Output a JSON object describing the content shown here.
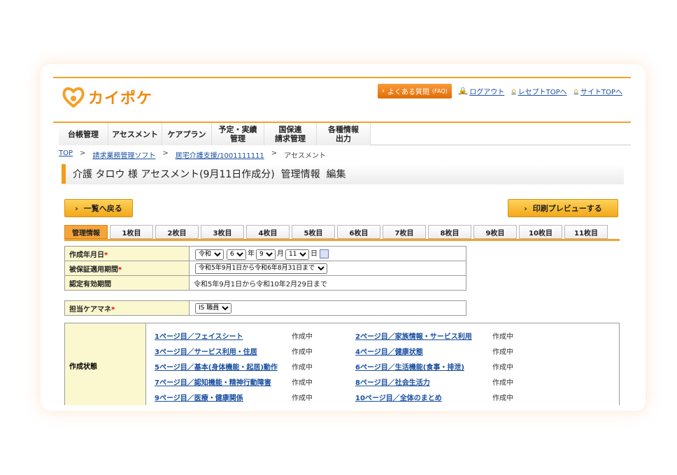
{
  "header": {
    "logo_text": "カイポケ",
    "faq_label": "よくある質問",
    "faq_suffix": "(FAQ)",
    "logout_label": "ログアウト",
    "receipt_top_label": "レセプトTOPへ",
    "site_top_label": "サイトTOPへ"
  },
  "nav": [
    {
      "label": "台帳管理"
    },
    {
      "label": "アセスメント"
    },
    {
      "label": "ケアプラン"
    },
    {
      "label": "予定・実績\n管理"
    },
    {
      "label": "国保連\n請求管理"
    },
    {
      "label": "各種情報\n出力"
    }
  ],
  "breadcrumb": {
    "top": "TOP",
    "sep": ">",
    "billing": "請求業務管理ソフト",
    "office": "居宅介護支援/1001111111",
    "current": "アセスメント"
  },
  "page_title": "介護 タロウ 様 アセスメント(9月11日作成分)  管理情報  編集",
  "buttons": {
    "back_label": "一覧へ戻る",
    "print_label": "印刷プレビューする",
    "arrow": "›"
  },
  "tabs": [
    "管理情報",
    "1枚目",
    "2枚目",
    "3枚目",
    "4枚目",
    "5枚目",
    "6枚目",
    "7枚目",
    "8枚目",
    "9枚目",
    "10枚目",
    "11枚目"
  ],
  "form": {
    "created_date": {
      "label": "作成年月日",
      "required_mark": "*",
      "era": "令和",
      "year": "6",
      "year_unit": "年",
      "month": "9",
      "month_unit": "月",
      "day": "11",
      "day_unit": "日"
    },
    "insurance_period": {
      "label": "被保証適用期間",
      "required_mark": "*",
      "value": "令和5年9月1日から令和6年8月31日まで"
    },
    "cert_period": {
      "label": "認定有効期間",
      "value": "令和5年9月1日から令和10年2月29日まで"
    },
    "care_manager": {
      "label": "担当ケアマネ",
      "required_mark": "*",
      "value": "IS 職員"
    }
  },
  "status": {
    "label": "作成状態",
    "items": [
      {
        "link": "1ページ目／フェイスシート",
        "state": "作成中"
      },
      {
        "link": "2ページ目／家族情報・サービス利用",
        "state": "作成中"
      },
      {
        "link": "3ページ目／サービス利用・住居",
        "state": "作成中"
      },
      {
        "link": "4ページ目／健康状態",
        "state": "作成中"
      },
      {
        "link": "5ページ目／基本(身体機能・起居)動作",
        "state": "作成中"
      },
      {
        "link": "6ページ目／生活機能(食事・排泄)",
        "state": "作成中"
      },
      {
        "link": "7ページ目／認知機能・精神行動障害",
        "state": "作成中"
      },
      {
        "link": "8ページ目／社会生活力",
        "state": "作成中"
      },
      {
        "link": "9ページ目／医療・健康関係",
        "state": "作成中"
      },
      {
        "link": "10ページ目／全体のまとめ",
        "state": "作成中"
      }
    ]
  },
  "colors": {
    "accent": "#f3a12a",
    "label_bg": "#fbf8cf",
    "link": "#1a4fa0",
    "required": "#e00000"
  }
}
